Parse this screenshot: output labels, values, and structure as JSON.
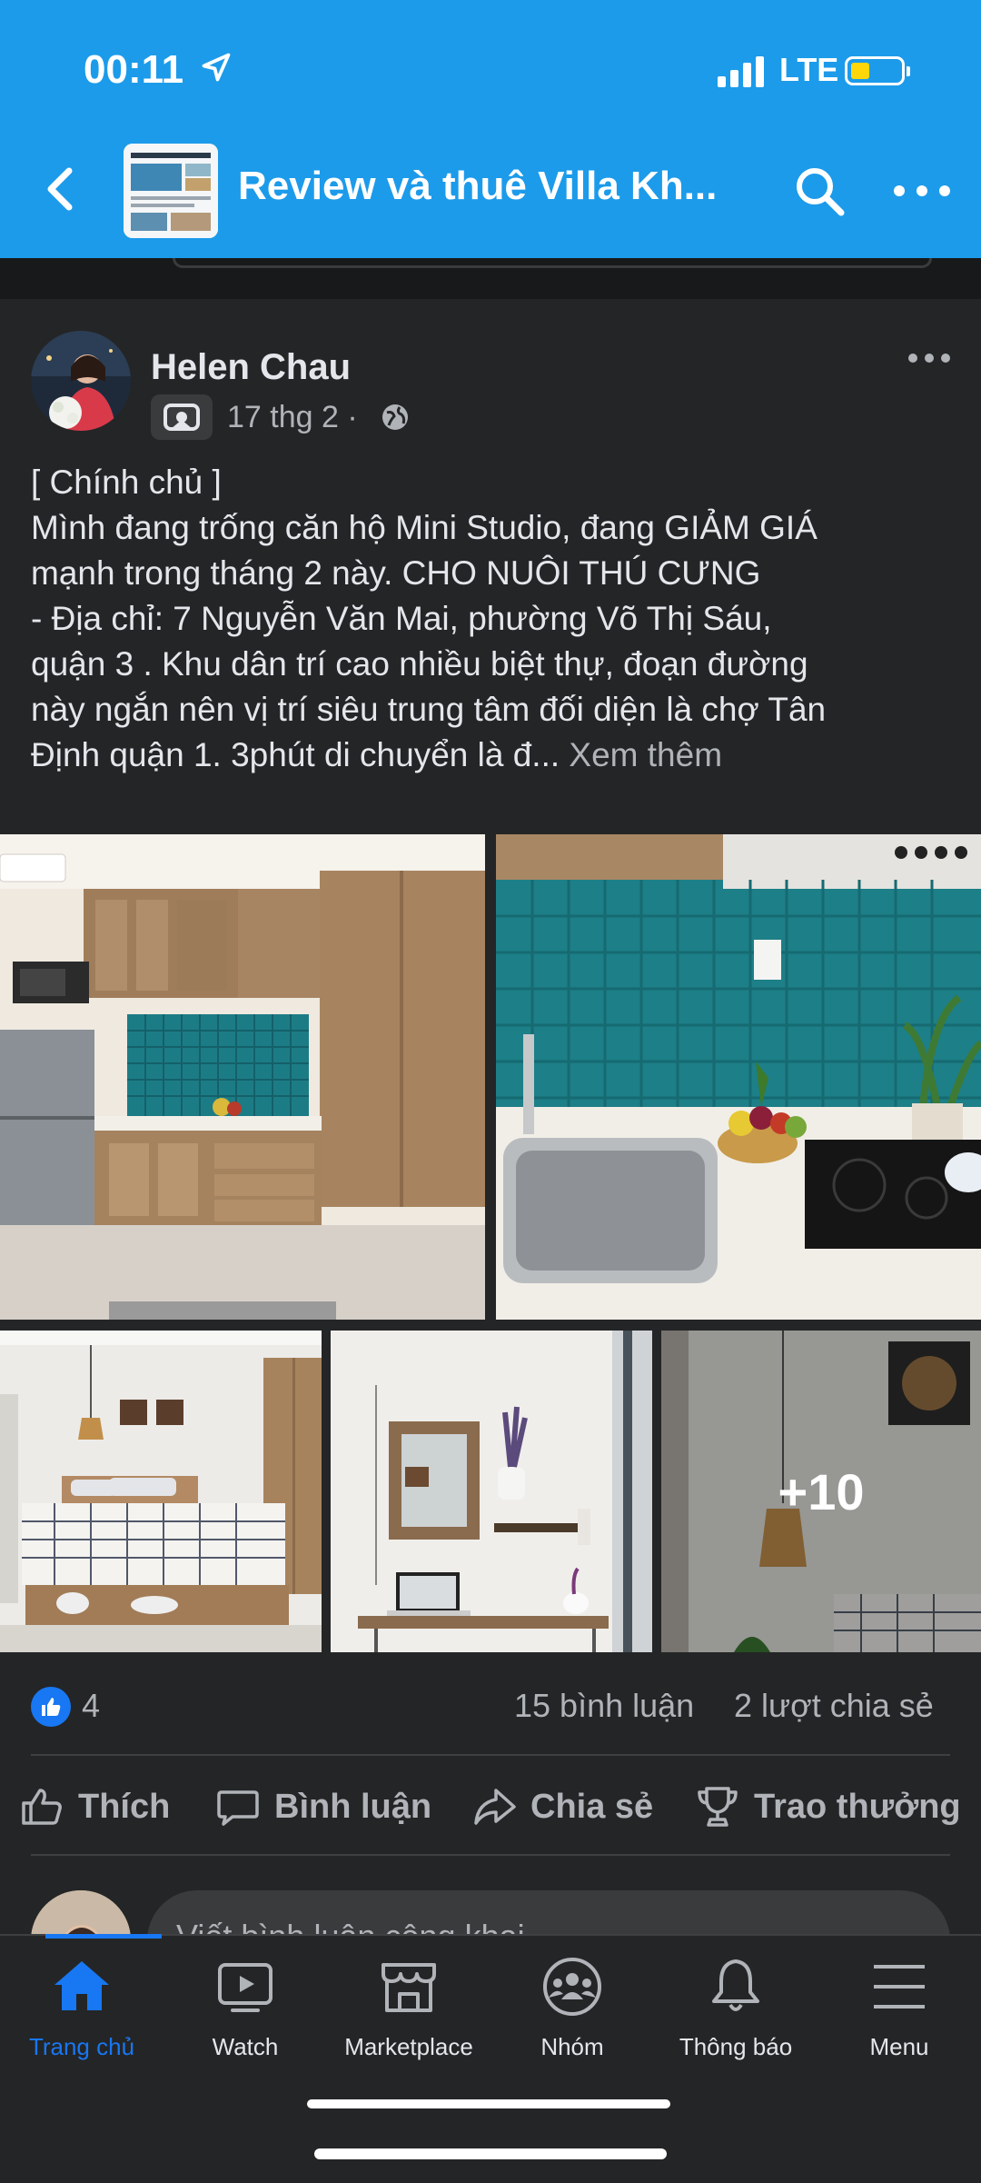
{
  "status_bar": {
    "time": "00:11",
    "network": "LTE"
  },
  "header": {
    "title": "Review và thuê Villa Kh..."
  },
  "post": {
    "author": "Helen Chau",
    "date": "17 thg 2",
    "separator": "·",
    "text_lines": [
      "[ Chính chủ ]",
      "Mình đang trống căn hộ Mini Studio, đang GIẢM GIÁ",
      "mạnh trong tháng 2 này. CHO NUÔI THÚ CƯNG",
      "- Địa chỉ: 7 Nguyễn Văn Mai, phường Võ Thị Sáu,",
      "quận 3 . Khu dân trí cao nhiều biệt thự, đoạn đường",
      "này ngắn nên vị trí siêu trung tâm đối diện là chợ Tân",
      "Định quận 1. 3phút di chuyển là đ..."
    ],
    "see_more": "Xem thêm",
    "more_photos": "+10"
  },
  "reactions": {
    "like_count": "4",
    "comments": "15 bình luận",
    "shares": "2 lượt chia sẻ"
  },
  "actions": {
    "like": "Thích",
    "comment": "Bình luận",
    "share": "Chia sẻ",
    "award": "Trao thưởng"
  },
  "composer": {
    "placeholder": "Viết bình luận công khai..."
  },
  "nav": {
    "home": "Trang chủ",
    "watch": "Watch",
    "marketplace": "Marketplace",
    "groups": "Nhóm",
    "notifications": "Thông báo",
    "menu": "Menu"
  },
  "colors": {
    "header": "#1c9bea",
    "accent": "#1877f2",
    "background": "#242526"
  }
}
